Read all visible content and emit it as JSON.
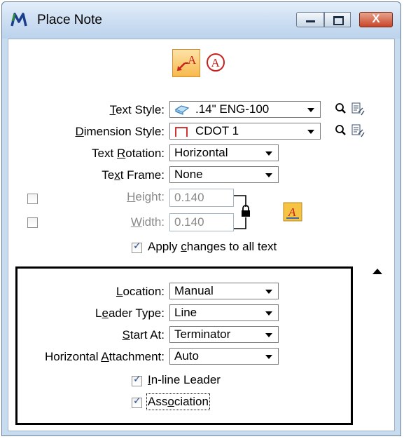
{
  "window": {
    "title": "Place Note",
    "buttons": {
      "minimize": "",
      "maximize": "",
      "close": "X"
    }
  },
  "mode_buttons": [
    "place-note-icon",
    "place-text-icon"
  ],
  "mode_glyphs": {
    "note": "A",
    "text": "A"
  },
  "text_style": {
    "label_pre": "",
    "label_ul": "T",
    "label_post": "ext Style:",
    "value": ".14\"  ENG-100"
  },
  "dimension_style": {
    "label_pre": "",
    "label_ul": "D",
    "label_post": "imension Style:",
    "value": "CDOT 1"
  },
  "text_rotation": {
    "label_pre": "Text ",
    "label_ul": "R",
    "label_post": "otation:",
    "value": "Horizontal"
  },
  "text_frame": {
    "label_pre": "Te",
    "label_ul": "x",
    "label_post": "t Frame:",
    "value": "None"
  },
  "height": {
    "label_pre": "",
    "label_ul": "H",
    "label_post": "eight:",
    "value": "0.140",
    "checked": false
  },
  "width": {
    "label_pre": "",
    "label_ul": "W",
    "label_post": "idth:",
    "value": "0.140",
    "checked": false
  },
  "apply_all": {
    "label_pre": "Apply ",
    "label_ul": "c",
    "label_post": "hanges to all text",
    "checked": true
  },
  "location": {
    "label_pre": "",
    "label_ul": "L",
    "label_post": "ocation:",
    "value": "Manual"
  },
  "leader_type": {
    "label_pre": "L",
    "label_ul": "e",
    "label_post": "ader Type:",
    "value": "Line"
  },
  "start_at": {
    "label_pre": "",
    "label_ul": "S",
    "label_post": "tart At:",
    "value": "Terminator"
  },
  "horizontal_attachment": {
    "label_pre": "Horizontal ",
    "label_ul": "A",
    "label_post": "ttachment:",
    "value": "Auto"
  },
  "inline_leader": {
    "label_pre": "",
    "label_ul": "I",
    "label_post": "n-line Leader",
    "checked": true
  },
  "association": {
    "label_pre": "Ass",
    "label_ul": "o",
    "label_post": "ciation",
    "checked": true
  },
  "colors": {
    "title_bar": "#c9dcf1",
    "active_mode": "#f7b94d",
    "close_button": "#c7452a",
    "text_icon_red": "#c8201e"
  }
}
